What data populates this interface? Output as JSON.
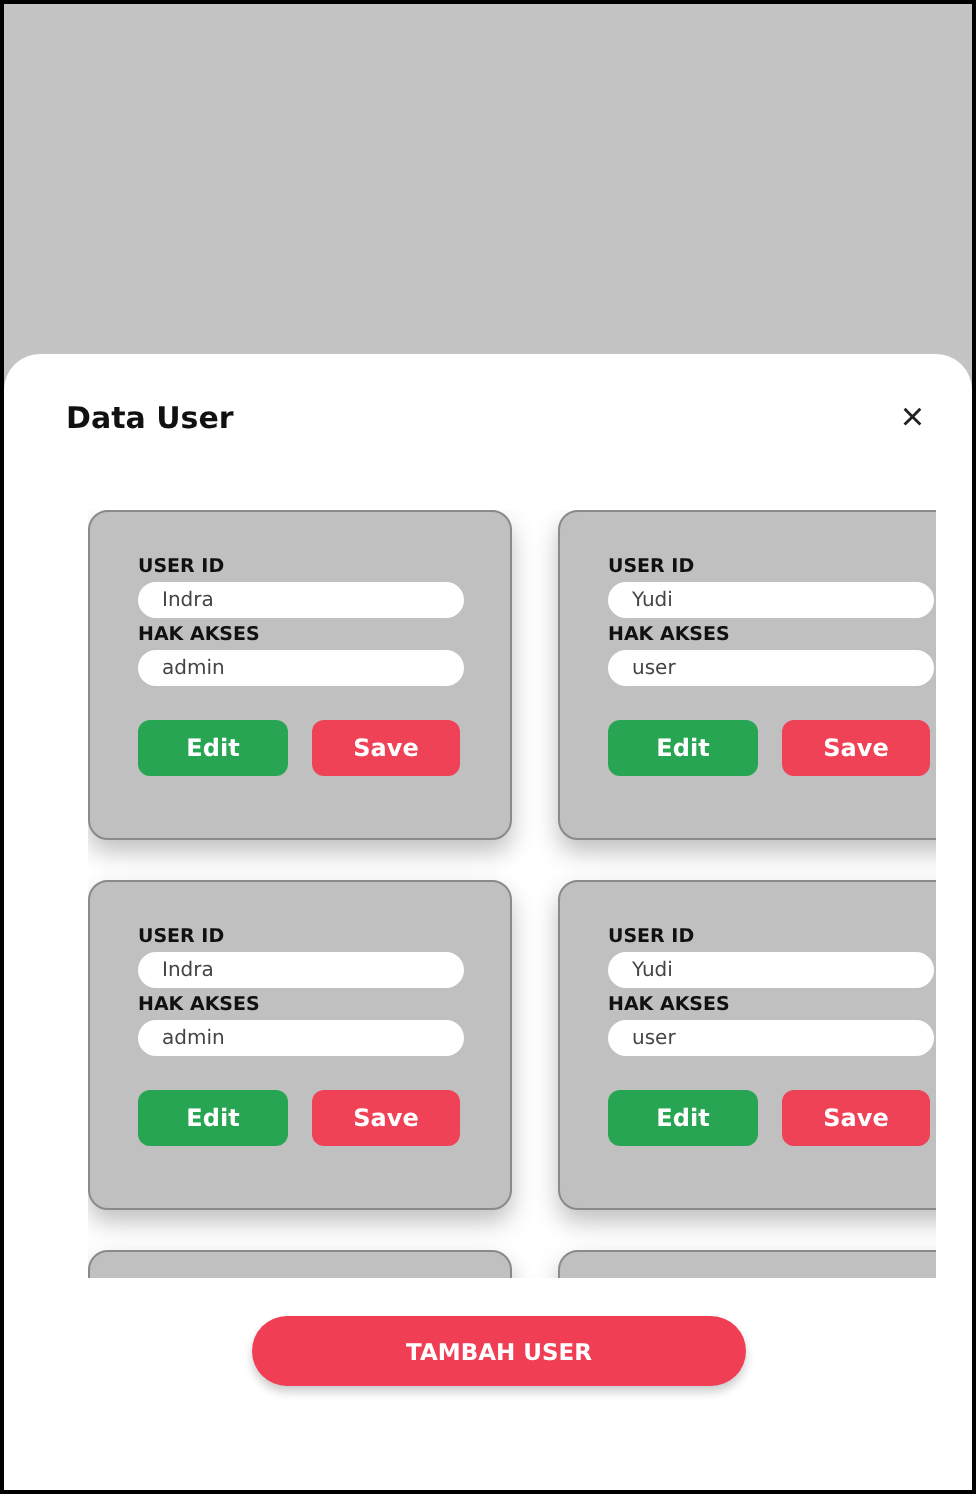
{
  "dialog": {
    "title": "Data User",
    "close": "×"
  },
  "cards": [
    {
      "kind": "user",
      "fields": [
        {
          "label": "USER ID",
          "value": "Indra"
        },
        {
          "label": "HAK AKSES",
          "value": "admin"
        }
      ],
      "buttons": [
        {
          "label": "Edit",
          "kind": "edit"
        },
        {
          "label": "Save",
          "kind": "save"
        }
      ]
    },
    {
      "kind": "user",
      "fields": [
        {
          "label": "USER ID",
          "value": "Yudi"
        },
        {
          "label": "HAK AKSES",
          "value": "user"
        }
      ],
      "buttons": [
        {
          "label": "Edit",
          "kind": "edit"
        },
        {
          "label": "Save",
          "kind": "save"
        }
      ]
    },
    {
      "kind": "user",
      "fields": [
        {
          "label": "USER ID",
          "value": "Indra"
        },
        {
          "label": "HAK AKSES",
          "value": "admin"
        }
      ],
      "buttons": [
        {
          "label": "Edit",
          "kind": "edit"
        },
        {
          "label": "Save",
          "kind": "save"
        }
      ]
    },
    {
      "kind": "user",
      "fields": [
        {
          "label": "USER ID",
          "value": "Yudi"
        },
        {
          "label": "HAK AKSES",
          "value": "user"
        }
      ],
      "buttons": [
        {
          "label": "Edit",
          "kind": "edit"
        },
        {
          "label": "Save",
          "kind": "save"
        }
      ]
    },
    {
      "kind": "clipped"
    },
    {
      "kind": "clipped"
    }
  ],
  "add_button": "TAMBAH USER"
}
